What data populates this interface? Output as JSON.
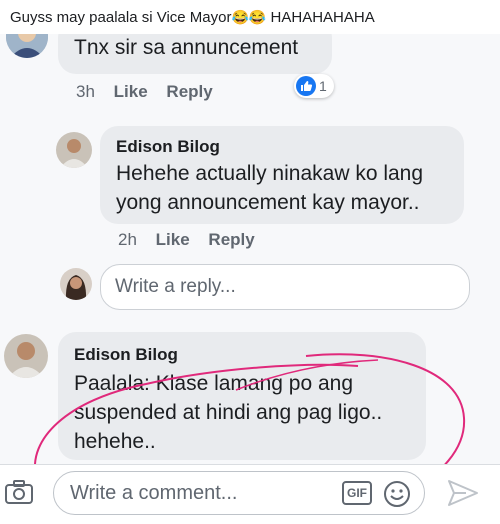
{
  "caption": {
    "text": "Guyss may paalala si Vice Mayor",
    "emoji": "😂😂",
    "suffix": " HAHAHAHAHA"
  },
  "comment1": {
    "text": "Tnx sir sa annuncement",
    "meta": {
      "time": "3h",
      "like": "Like",
      "reply": "Reply"
    },
    "reaction_count": "1"
  },
  "reply1": {
    "author": "Edison Bilog",
    "text_line1": "Hehehe actually ninakaw ko lang",
    "text_line2": "yong announcement kay mayor..",
    "meta": {
      "time": "2h",
      "like": "Like",
      "reply": "Reply"
    }
  },
  "reply_box": {
    "placeholder": "Write a reply..."
  },
  "comment2": {
    "author": "Edison Bilog",
    "text_line1": "Paalala: Klase lamang po ang",
    "text_line2": "suspended at hindi ang pag ligo..",
    "text_line3": "hehehe.."
  },
  "composer": {
    "placeholder": "Write a comment...",
    "gif_label": "GIF"
  },
  "colors": {
    "bubble": "#e9ebee",
    "like_blue": "#1877f2",
    "annotation": "#e0297b",
    "text_secondary": "#606770"
  }
}
